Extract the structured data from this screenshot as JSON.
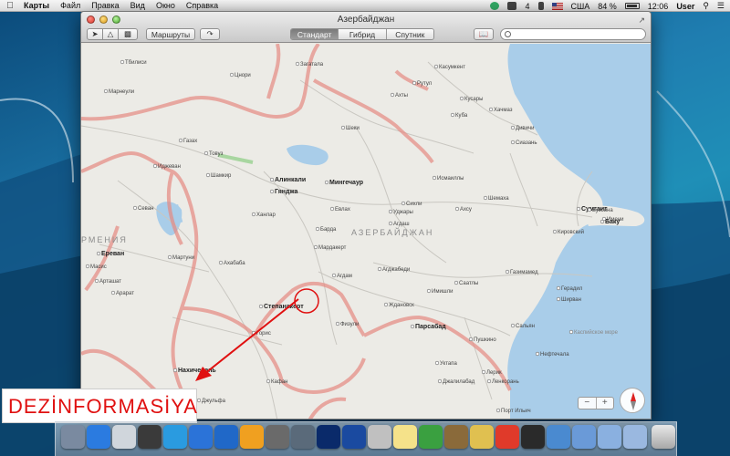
{
  "menubar": {
    "app_name": "Карты",
    "menus": [
      "Файл",
      "Правка",
      "Вид",
      "Окно",
      "Справка"
    ],
    "status": {
      "wifi_bars": "4",
      "input_source": "США",
      "battery": "84 %",
      "time": "12:06",
      "user": "User"
    }
  },
  "window": {
    "title": "Азербайджан",
    "toolbar": {
      "routes_label": "Маршруты",
      "map_modes": [
        "Стандарт",
        "Гибрид",
        "Спутник"
      ],
      "active_mode": "Стандарт",
      "search_placeholder": ""
    }
  },
  "map": {
    "country_labels": {
      "azerbaijan": "АЗЕРБАЙДЖАН",
      "armenia": "РМЕНИЯ"
    },
    "cities": [
      "Тбилиси",
      "Марнеули",
      "Цнори",
      "Загатала",
      "Касумкент",
      "Рутул",
      "Ахты",
      "Кусары",
      "Куба",
      "Хачмаз",
      "Дивичи",
      "Сиазань",
      "Шеки",
      "Газах",
      "Товуз",
      "Шамкир",
      "Иджеван",
      "Севан",
      "Алинкали",
      "Гянджа",
      "Мингечаур",
      "Ханлар",
      "Исмаиллы",
      "Шемаха",
      "Ахсу",
      "Сумгаит",
      "Баку",
      "Бузовна",
      "Имени",
      "Кировский",
      "Евлах",
      "Уджары",
      "Сихли",
      "Агдаш",
      "Барда",
      "Мардакерт",
      "Ереван",
      "Мартуни",
      "Масис",
      "Арташат",
      "Ахабаба",
      "Агдам",
      "Агджабеди",
      "Имишли",
      "Саатлы",
      "Газимамед",
      "Герадил",
      "Ширван",
      "Арарат",
      "Степанакерт",
      "Ждановск",
      "Физули",
      "Пушкино",
      "Сальян",
      "Нефтечала",
      "Горис",
      "Нахичевань",
      "Кафан",
      "Парсабад",
      "Уктапа",
      "Джалилабад",
      "Джульфа",
      "Лерик",
      "Ленкорань",
      "Порт Ильич",
      "Каспийское море"
    ]
  },
  "annotation": {
    "label": "DEZİNFORMASİYA"
  },
  "colors": {
    "water": "#a9cde9",
    "land": "#ecebe6",
    "border": "#e58a82",
    "annotation_red": "#e01010"
  }
}
